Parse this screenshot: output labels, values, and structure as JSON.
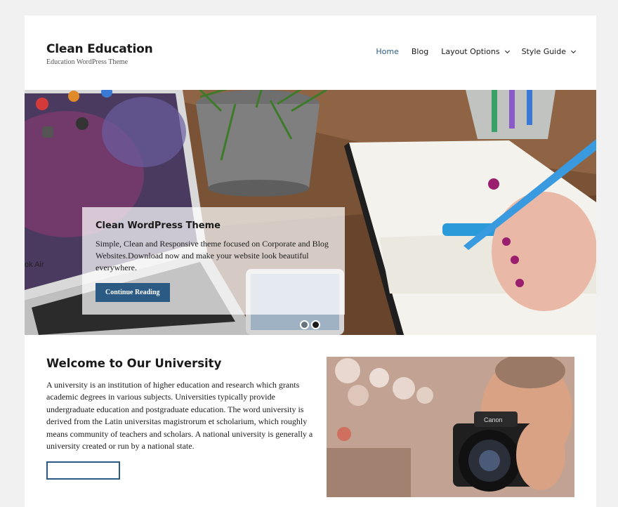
{
  "site": {
    "title": "Clean Education",
    "description": "Education WordPress Theme"
  },
  "nav": {
    "items": [
      {
        "label": "Home",
        "active": true
      },
      {
        "label": "Blog"
      },
      {
        "label": "Layout Options",
        "has_submenu": true
      },
      {
        "label": "Style Guide",
        "has_submenu": true
      }
    ]
  },
  "slider": {
    "caption_title": "Clean WordPress Theme",
    "caption_text": "Simple, Clean and Responsive theme focused on Corporate and Blog Websites.Download now and make your website look beautiful everywhere.",
    "button_label": "Continue Reading",
    "slide_count": 2,
    "active_slide": 2,
    "laptop_text": "ok Air"
  },
  "welcome": {
    "title": "Welcome to Our University",
    "text": "A university is an institution of higher education and research which grants academic degrees in various subjects. Universities typically provide undergraduate education and postgraduate education. The word university is derived from the Latin universitas magistrorum et scholarium, which roughly means community of teachers and scholars. A national university is generally a university created or run by a national state."
  },
  "photo": {
    "camera_brand": "Canon"
  },
  "colors": {
    "accent": "#2b5b84",
    "background": "#f1f1f1"
  }
}
